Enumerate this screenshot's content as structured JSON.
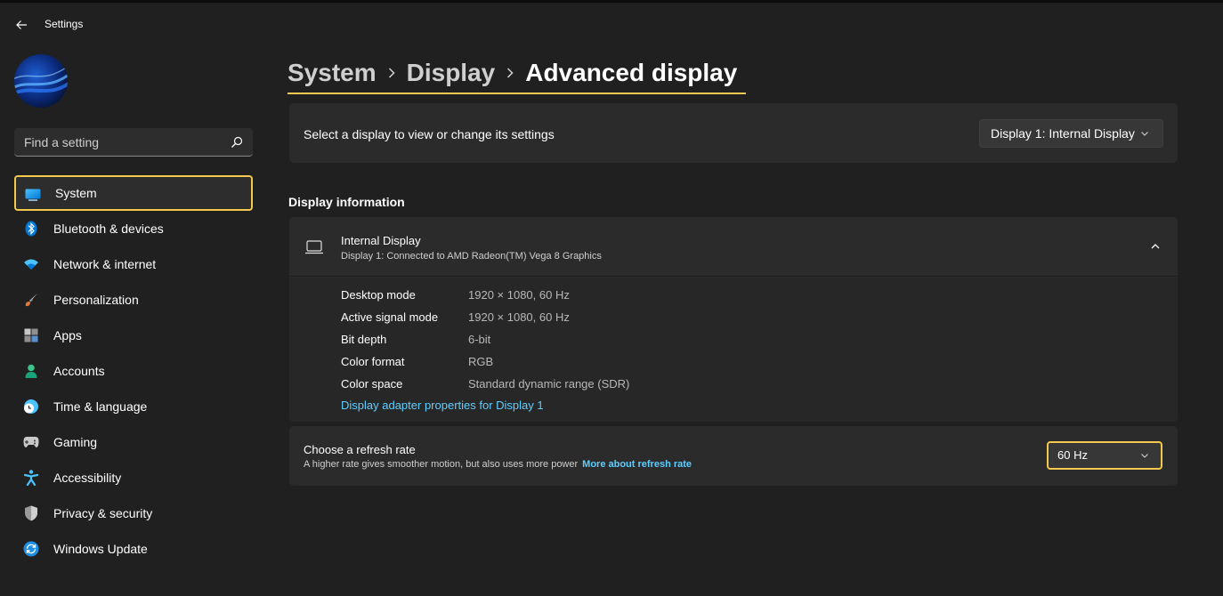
{
  "window": {
    "title": "Settings"
  },
  "search": {
    "placeholder": "Find a setting"
  },
  "sidebar": {
    "items": [
      {
        "label": "System",
        "icon": "monitor-icon",
        "selected": true
      },
      {
        "label": "Bluetooth & devices",
        "icon": "bluetooth-icon"
      },
      {
        "label": "Network & internet",
        "icon": "wifi-icon"
      },
      {
        "label": "Personalization",
        "icon": "brush-icon"
      },
      {
        "label": "Apps",
        "icon": "apps-icon"
      },
      {
        "label": "Accounts",
        "icon": "person-icon"
      },
      {
        "label": "Time & language",
        "icon": "clock-globe-icon"
      },
      {
        "label": "Gaming",
        "icon": "gamepad-icon"
      },
      {
        "label": "Accessibility",
        "icon": "accessibility-icon"
      },
      {
        "label": "Privacy & security",
        "icon": "shield-icon"
      },
      {
        "label": "Windows Update",
        "icon": "update-icon"
      }
    ]
  },
  "breadcrumb": {
    "items": [
      "System",
      "Display",
      "Advanced display"
    ]
  },
  "display_select": {
    "label": "Select a display to view or change its settings",
    "value": "Display 1: Internal Display"
  },
  "display_info": {
    "section_title": "Display information",
    "name": "Internal Display",
    "subtitle": "Display 1: Connected to AMD Radeon(TM) Vega 8 Graphics",
    "rows": [
      {
        "key": "Desktop mode",
        "value": "1920 × 1080, 60 Hz"
      },
      {
        "key": "Active signal mode",
        "value": "1920 × 1080, 60 Hz"
      },
      {
        "key": "Bit depth",
        "value": "6-bit"
      },
      {
        "key": "Color format",
        "value": "RGB"
      },
      {
        "key": "Color space",
        "value": "Standard dynamic range (SDR)"
      }
    ],
    "adapter_link": "Display adapter properties for Display 1"
  },
  "refresh_rate": {
    "title": "Choose a refresh rate",
    "description": "A higher rate gives smoother motion, but also uses more power",
    "link": "More about refresh rate",
    "value": "60 Hz"
  },
  "colors": {
    "background": "#202020",
    "card": "#2b2b2b",
    "highlight": "#f2c94c",
    "link": "#60cdff"
  }
}
